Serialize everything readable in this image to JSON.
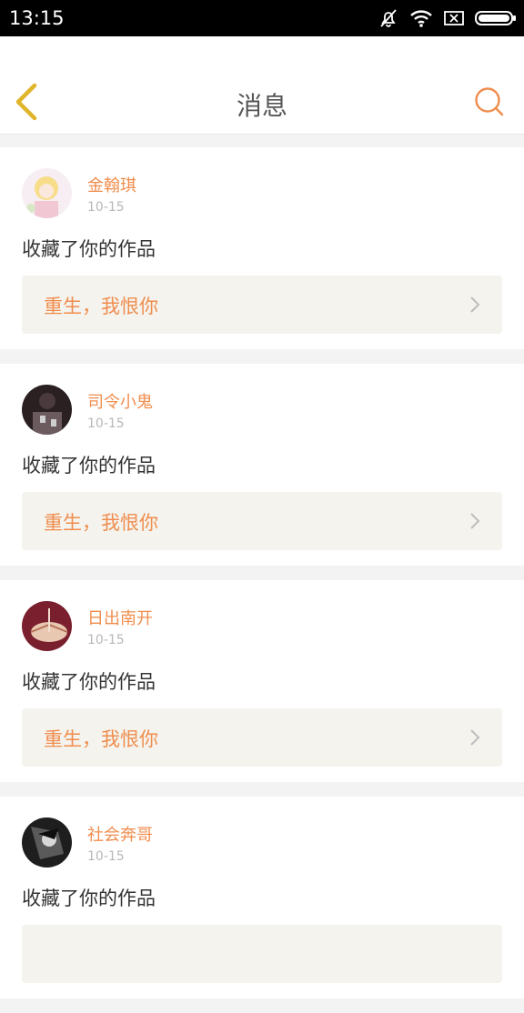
{
  "status_bar": {
    "time": "13:15",
    "icons": [
      "bell-muted-icon",
      "wifi-icon",
      "sim-x-icon",
      "battery-icon"
    ]
  },
  "header": {
    "title": "消息",
    "back_icon": "chevron-left-icon",
    "search_icon": "search-icon"
  },
  "colors": {
    "accent": "#f08d4d",
    "back_icon": "#e0b52c",
    "card_link_bg": "#f4f3ee"
  },
  "messages": [
    {
      "username": "金翰琪",
      "time": "10-15",
      "action": "收藏了你的作品",
      "work_title": "重生，我恨你"
    },
    {
      "username": "司令小鬼",
      "time": "10-15",
      "action": "收藏了你的作品",
      "work_title": "重生，我恨你"
    },
    {
      "username": "日出南开",
      "time": "10-15",
      "action": "收藏了你的作品",
      "work_title": "重生，我恨你"
    },
    {
      "username": "社会奔哥",
      "time": "10-15",
      "action": "收藏了你的作品",
      "work_title": ""
    }
  ]
}
